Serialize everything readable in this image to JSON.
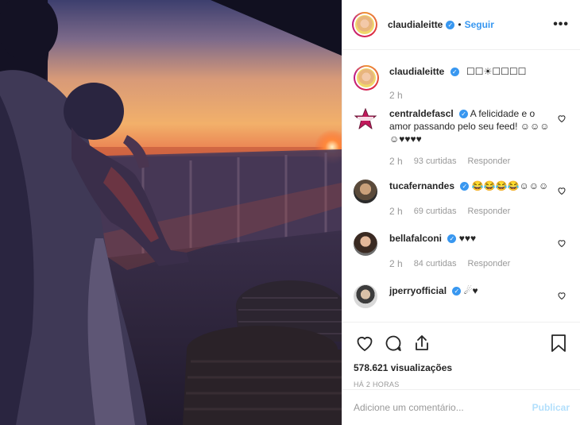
{
  "header": {
    "username": "claudialeitte",
    "follow_label": "Seguir",
    "separator": "•",
    "more_label": "•••"
  },
  "caption": {
    "username": "claudialeitte",
    "text": "☐☐☀☐☐☐☐",
    "time": "2 h"
  },
  "comments": [
    {
      "username": "centraldefascl",
      "verified": true,
      "text": "A felicidade e o amor passando pelo seu feed! ☺☺☺☺♥♥♥♥",
      "time": "2 h",
      "likes": "93 curtidas",
      "reply": "Responder"
    },
    {
      "username": "tucafernandes",
      "verified": true,
      "text": "😂😂😂😂☺☺☺",
      "time": "2 h",
      "likes": "69 curtidas",
      "reply": "Responder"
    },
    {
      "username": "bellafalconi",
      "verified": true,
      "text": "♥♥♥",
      "time": "2 h",
      "likes": "84 curtidas",
      "reply": "Responder"
    },
    {
      "username": "jperryofficial",
      "verified": true,
      "text": "☄♥",
      "time": "",
      "likes": "",
      "reply": ""
    }
  ],
  "stats": {
    "views": "578.621 visualizações",
    "posted": "HÁ 2 HORAS"
  },
  "add_comment": {
    "placeholder": "Adicione um comentário...",
    "publish_label": "Publicar"
  },
  "colors": {
    "link_blue": "#3897f0",
    "publish_disabled": "#b2dffc",
    "muted": "#999999"
  },
  "icons": [
    "heart-icon",
    "comment-icon",
    "share-icon",
    "bookmark-icon",
    "more-options-icon",
    "verified-badge-icon"
  ]
}
